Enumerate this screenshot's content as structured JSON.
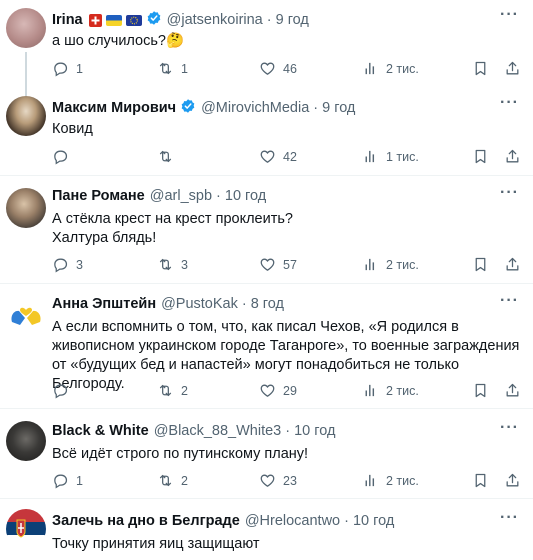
{
  "tweets": [
    {
      "name": "Irina",
      "handle": "@jatsenkoirina",
      "time": "9 год",
      "text": "а шо случилось?🤔",
      "reply_count": "1",
      "retweet_count": "1",
      "like_count": "46",
      "view_count": "2 тис."
    },
    {
      "name": "Максим Мирович",
      "handle": "@MirovichMedia",
      "time": "9 год",
      "text": "Ковид",
      "reply_count": "",
      "retweet_count": "",
      "like_count": "42",
      "view_count": "1 тис."
    },
    {
      "name": "Пане Романе",
      "handle": "@arl_spb",
      "time": "10 год",
      "text_line1": "А стёкла крест на крест проклеить?",
      "text_line2": "Халтура блядь!",
      "reply_count": "3",
      "retweet_count": "3",
      "like_count": "57",
      "view_count": "2 тис."
    },
    {
      "name": "Анна Эпштейн",
      "handle": "@PustoKak",
      "time": "8 год",
      "text_line1": "А если вспомнить о том, что, как писал Чехов, «Я родился в",
      "text_line2": "живописном украинском городе Таганроге», то  военные заграждения",
      "text_line3": "от «будущих бед и напастей» могут понадобиться не только Белгороду.",
      "reply_count": "",
      "retweet_count": "2",
      "like_count": "29",
      "view_count": "2 тис."
    },
    {
      "name": "Black & White",
      "handle": "@Black_88_White3",
      "time": "10 год",
      "text": "Всё идёт строго по путинскому плану!",
      "reply_count": "1",
      "retweet_count": "2",
      "like_count": "23",
      "view_count": "2 тис."
    },
    {
      "name": "Залечь на дно в Белграде",
      "handle": "@Hrelocantwo",
      "time": "10 год",
      "text": "Точку принятия яиц защищают"
    }
  ],
  "dot": "·",
  "more_label": "···",
  "icons": {
    "reply": "reply-icon",
    "retweet": "retweet-icon",
    "like": "heart-icon",
    "views": "views-chart-icon",
    "bookmark": "bookmark-icon",
    "share": "share-icon",
    "verified": "verified-badge-icon"
  },
  "colors": {
    "text": "#0f1419",
    "secondary": "#536471",
    "verified": "#1d9bf0",
    "divider": "#eff3f4"
  }
}
